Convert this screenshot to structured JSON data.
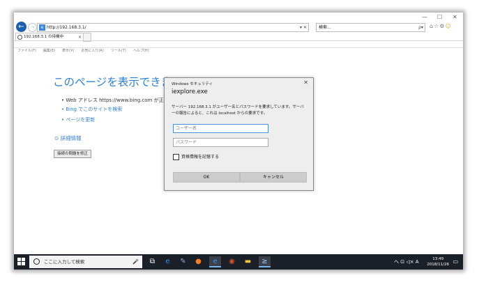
{
  "browser": {
    "window_controls": [
      "—",
      "☐",
      "✕"
    ],
    "address": "http://192.168.3.1/",
    "address_controls": "▾ ✕",
    "search_placeholder": "検索...",
    "search_controls": "ρ▾",
    "tab_title": "192.168.3.1 の待機中",
    "tab_close": "×",
    "menu": [
      "ファイル(F)",
      "編集(E)",
      "表示(V)",
      "お気に入り(A)",
      "ツール(T)",
      "ヘルプ(H)"
    ]
  },
  "error_page": {
    "title": "このページを表示できません",
    "bullets": [
      "• Web アドレス https://www.bing.com が正しい",
      "• Bing でこのサイトを検索",
      "• ページを更新"
    ],
    "details": "⊙ 詳細情報",
    "fix_button": "接続の問題を修正"
  },
  "dialog": {
    "caption": "Windows セキュリティ",
    "close": "✕",
    "app_name": "iexplore.exe",
    "message": "サーバー 192.168.3.1 がユーザー名とパスワードを要求しています。サーバーの報告によると、これは localhost からの要求です。",
    "username_placeholder": "ユーザー名",
    "password_placeholder": "パスワード",
    "remember_label": "資格情報を記憶する",
    "ok_label": "OK",
    "cancel_label": "キャンセル"
  },
  "taskbar": {
    "search_placeholder": "ここに入力して検索",
    "tray_text": "へ  ⊡  ◁×  A",
    "time": "13:49",
    "date": "2018/11/26"
  }
}
